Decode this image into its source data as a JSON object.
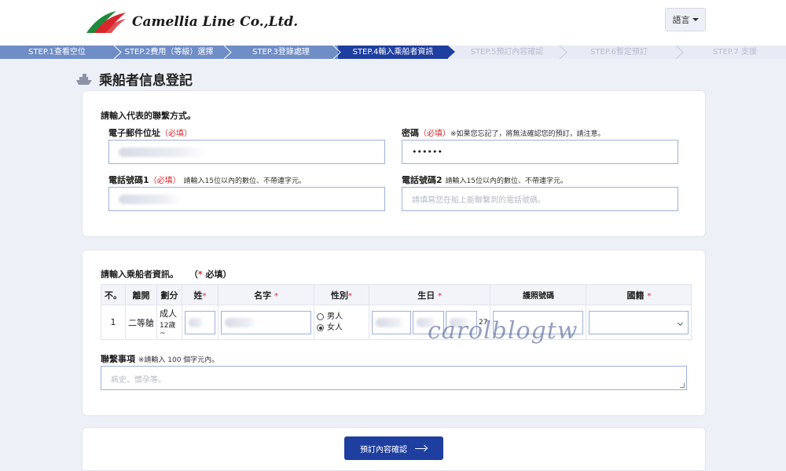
{
  "header": {
    "brand": "Camellia Line Co.,Ltd.",
    "language_button": "語言"
  },
  "steps": [
    {
      "label": "STEP.1查看空位",
      "state": "done"
    },
    {
      "label": "STEP.2費用（等級）選擇",
      "state": "done"
    },
    {
      "label": "STEP.3登錄處理",
      "state": "done"
    },
    {
      "label": "STEP.4輸入乘船者資訊",
      "state": "current"
    },
    {
      "label": "STEP.5預訂內容確認",
      "state": "todo"
    },
    {
      "label": "STEP.6暫定預訂",
      "state": "todo"
    },
    {
      "label": "STEP.7 支援",
      "state": "todo"
    }
  ],
  "page_title": "乘船者信息登記",
  "contact": {
    "section_title": "請輸入代表的聯繫方式。",
    "email_label": "電子郵件位址",
    "required": "（必填）",
    "password_label": "密碼",
    "password_note": "※如果您忘記了，將無法確認您的預訂，請注意。",
    "password_value": "••••••",
    "phone1_label": "電話號碼1",
    "phone1_note": "請輸入15位以內的數位、不帶連字元。",
    "phone2_label": "電話號碼2",
    "phone2_note": "請輸入15位以內的數位、不帶連字元。",
    "phone2_placeholder": "請填寫您在船上能聯繫到的電話號碼。"
  },
  "passengers": {
    "section_title": "請輸入乘船者資訊。",
    "required_hint": "（",
    "required_hint_star": "*",
    "required_hint_end": " 必填）",
    "columns": {
      "no": "不。",
      "cabin": "離開",
      "category": "劃分",
      "surname": "姓",
      "given_name": "名字",
      "gender": "性別",
      "birthday": "生日",
      "passport": "護照號碼",
      "nationality": "國籍"
    },
    "star": "*",
    "row": {
      "no": "1",
      "cabin": "二等艙",
      "category": "成人",
      "category_sub": "12歲~",
      "gender_male": "男人",
      "gender_female": "女人",
      "gender_selected": "女人",
      "birth_suffix": "27"
    }
  },
  "remarks": {
    "label": "聯繫事項",
    "note": "※請輸入 100 個字元內。",
    "placeholder": "病史、懷孕等。"
  },
  "watermark": "carolblogtw",
  "confirm_button": "預訂內容確認",
  "colors": {
    "primary": "#1e3fa0",
    "step_done": "#6f8dc6",
    "required": "#d9262c",
    "page_bg": "#eef0f8"
  }
}
